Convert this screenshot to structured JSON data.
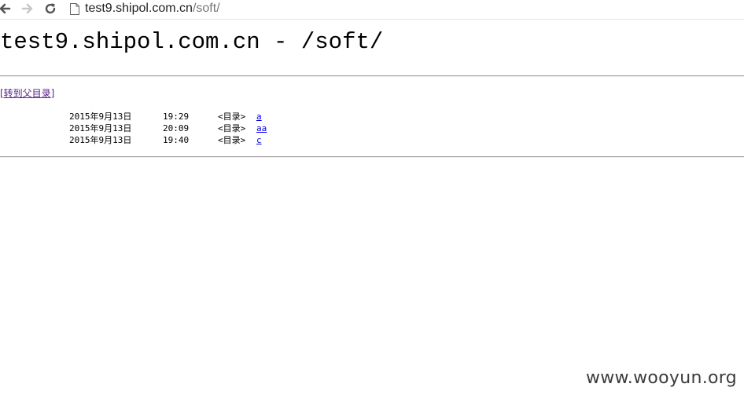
{
  "browser": {
    "url_host": "test9.shipol.com.cn",
    "url_path": "/soft/"
  },
  "page": {
    "title": "test9.shipol.com.cn - /soft/",
    "parent_link": "[转到父目录]"
  },
  "listing": [
    {
      "date": "2015年9月13日",
      "time": "19:29",
      "type": "<目录>",
      "name": "a"
    },
    {
      "date": "2015年9月13日",
      "time": "20:09",
      "type": "<目录>",
      "name": "aa"
    },
    {
      "date": "2015年9月13日",
      "time": "19:40",
      "type": "<目录>",
      "name": "c"
    }
  ],
  "watermark": "www.wooyun.org"
}
